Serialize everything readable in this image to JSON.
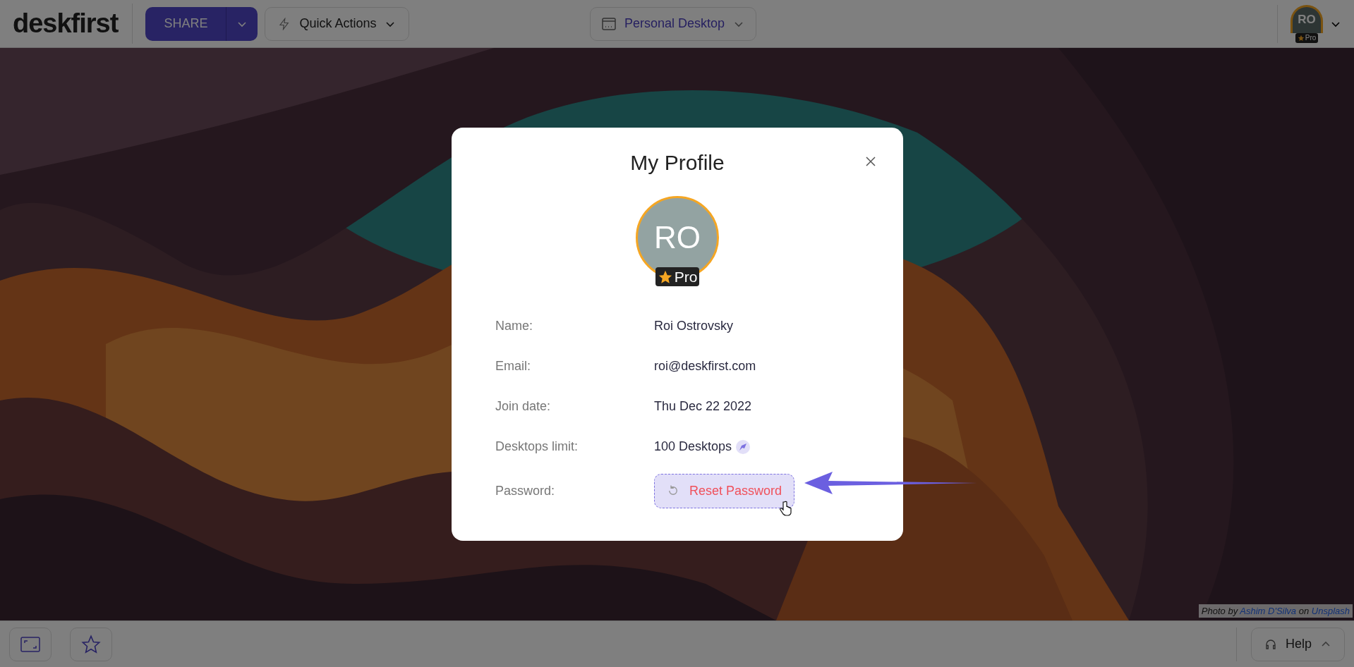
{
  "header": {
    "logo": "deskfirst",
    "share_button": "SHARE",
    "quick_actions": "Quick Actions",
    "desktop_selector": "Personal Desktop",
    "avatar": {
      "initials": "RO",
      "badge": "Pro"
    }
  },
  "photo_credit": {
    "prefix": "Photo by",
    "author": "Ashim D'Silva",
    "middle": "on",
    "source": "Unsplash"
  },
  "modal": {
    "title": "My Profile",
    "avatar": {
      "initials": "RO",
      "badge": "Pro"
    },
    "fields": [
      {
        "label": "Name:",
        "value": "Roi Ostrovsky",
        "kind": "text"
      },
      {
        "label": "Email:",
        "value": "roi@deskfirst.com",
        "kind": "text"
      },
      {
        "label": "Join date:",
        "value": "Thu Dec 22 2022",
        "kind": "text"
      },
      {
        "label": "Desktops limit:",
        "value": "100 Desktops",
        "kind": "limit"
      },
      {
        "label": "Password:",
        "value": "Reset Password",
        "kind": "button"
      }
    ]
  },
  "footer": {
    "help": "Help"
  }
}
